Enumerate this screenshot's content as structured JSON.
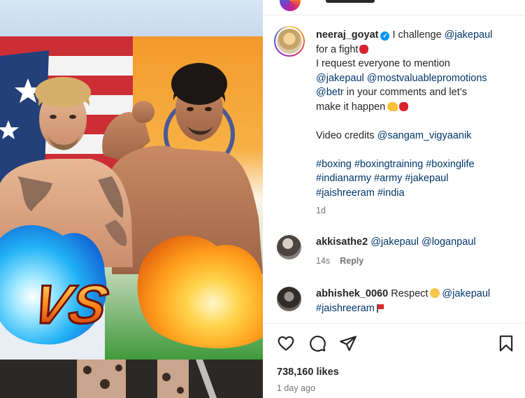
{
  "post": {
    "author": "neeraj_goyat",
    "verified_icon": "verified-badge-icon",
    "caption": {
      "l1_text": "I challenge",
      "l1_mention": "@jakepaul",
      "l2_text": "for a fight",
      "l3_text": "I request everyone to mention",
      "l4_mention_a": "@jakepaul",
      "l4_mention_b": "@mostvaluablepromotions",
      "l5_mention": "@betr",
      "l5_text": "in your comments and let’s",
      "l6_text": "make it happen",
      "l8_text": "Video credits",
      "l8_mention": "@sangam_vigyaanik",
      "tags": [
        "#boxing",
        "#boxingtraining",
        "#boxinglife",
        "#indianarmy",
        "#army",
        "#jakepaul",
        "#jaishreeram",
        "#india"
      ]
    },
    "caption_age": "1d"
  },
  "comments": [
    {
      "user": "akkisathe2",
      "mention_a": "@jakepaul",
      "mention_b": "@loganpaul",
      "age": "14s",
      "reply_label": "Reply"
    },
    {
      "user": "abhishek_0060",
      "text": "Respect",
      "mention": "@jakepaul",
      "tag": "#jaishreeram"
    }
  ],
  "likes": "738,160 likes",
  "time_ago": "1 day ago",
  "media": {
    "vs_text": "VS"
  },
  "colors": {
    "link": "#00376b",
    "verified": "#0095f6",
    "muted": "#737373",
    "text": "#262626"
  }
}
